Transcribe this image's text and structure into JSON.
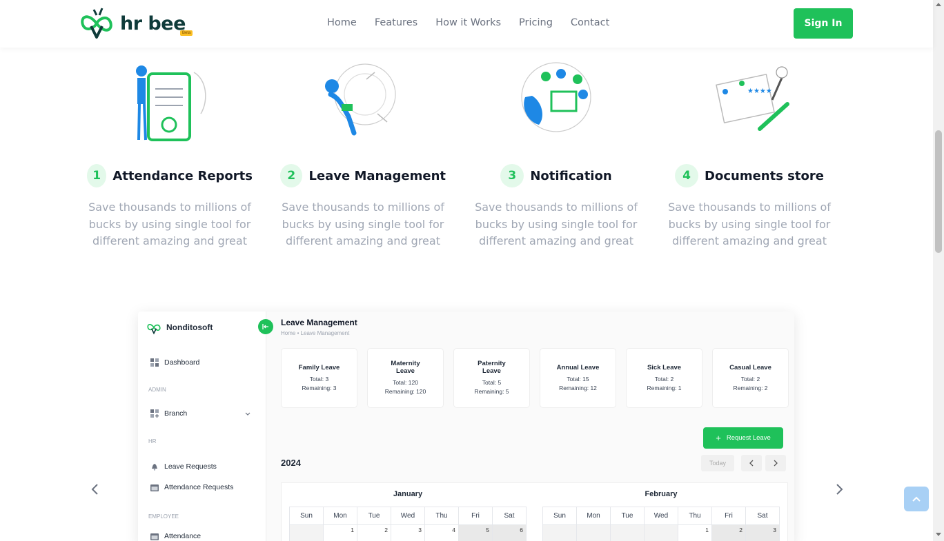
{
  "brand": {
    "name": "hr bee",
    "badge": "Beta"
  },
  "nav": {
    "items": [
      "Home",
      "Features",
      "How it Works",
      "Pricing",
      "Contact"
    ],
    "signin": "Sign In"
  },
  "features": [
    {
      "num": "1",
      "title": "Attendance Reports",
      "desc": "Save thousands to millions of bucks by using single tool for different amazing and great"
    },
    {
      "num": "2",
      "title": "Leave Management",
      "desc": "Save thousands to millions of bucks by using single tool for different amazing and great"
    },
    {
      "num": "3",
      "title": "Notification",
      "desc": "Save thousands to millions of bucks by using single tool for different amazing and great"
    },
    {
      "num": "4",
      "title": "Documents store",
      "desc": "Save thousands to millions of bucks by using single tool for different amazing and great"
    }
  ],
  "app": {
    "org": "Nonditosoft",
    "sidebar": {
      "dashboard": "Dashboard",
      "admin_section": "ADMIN",
      "branch": "Branch",
      "hr_section": "HR",
      "leave_requests": "Leave Requests",
      "attendance_requests": "Attendance Requests",
      "employee_section": "EMPLOYEE",
      "attendance": "Attendance"
    },
    "title": "Leave Management",
    "breadcrumb": "Home  •  Leave Management",
    "leave_types": [
      {
        "name": "Family Leave",
        "total": "Total: 3",
        "remaining": "Remaining: 3"
      },
      {
        "name": "Maternity Leave",
        "total": "Total: 120",
        "remaining": "Remaining: 120"
      },
      {
        "name": "Paternity Leave",
        "total": "Total: 5",
        "remaining": "Remaining: 5"
      },
      {
        "name": "Annual Leave",
        "total": "Total: 15",
        "remaining": "Remaining: 12"
      },
      {
        "name": "Sick Leave",
        "total": "Total: 2",
        "remaining": "Remaining: 1"
      },
      {
        "name": "Casual Leave",
        "total": "Total: 2",
        "remaining": "Remaining: 2"
      }
    ],
    "request_button": "Request Leave",
    "year": "2024",
    "today": "Today",
    "weekdays": [
      "Sun",
      "Mon",
      "Tue",
      "Wed",
      "Thu",
      "Fri",
      "Sat"
    ],
    "months": [
      {
        "name": "January",
        "first_row": [
          "",
          "1",
          "2",
          "3",
          "4",
          "5",
          "6"
        ]
      },
      {
        "name": "February",
        "first_row": [
          "",
          "",
          "",
          "",
          "1",
          "2",
          "3"
        ]
      }
    ]
  },
  "colors": {
    "accent": "#1fc15a",
    "dark": "#0f3b3a",
    "muted": "#a0a7b4"
  }
}
